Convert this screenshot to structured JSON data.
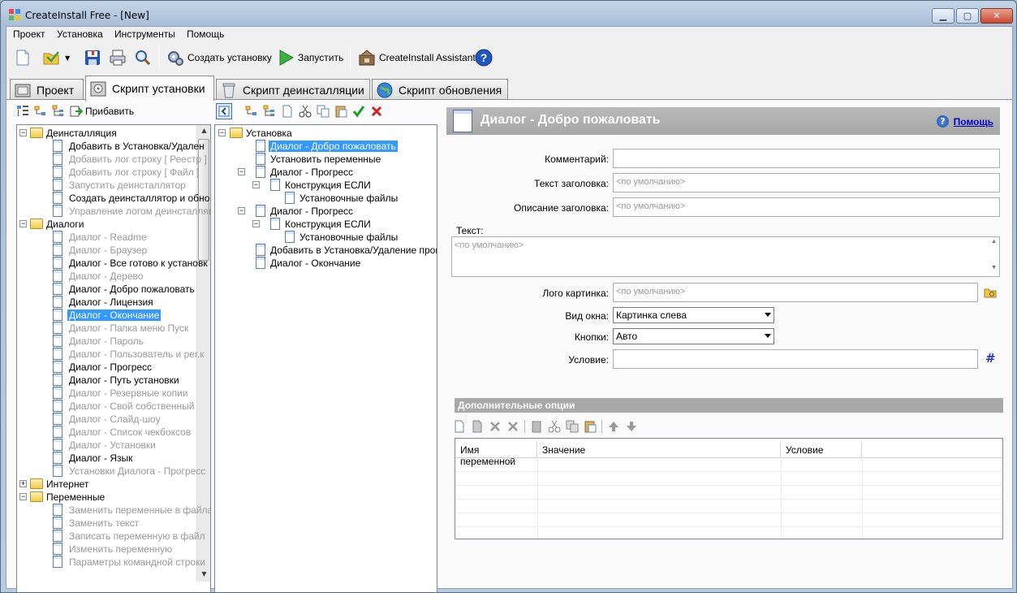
{
  "window": {
    "title": "CreateInstall Free - [New]",
    "min": "▁",
    "max": "▢",
    "close": "✕"
  },
  "menu": [
    "Проект",
    "Установка",
    "Инструменты",
    "Помощь"
  ],
  "toolbar": {
    "create_install": "Создать установку",
    "run": "Запустить",
    "assistant": "CreateInstall Assistant"
  },
  "tabs": [
    "Проект",
    "Скрипт установки",
    "Скрипт деинсталляции",
    "Скрипт обновления"
  ],
  "left_toolbar": {
    "add": "Прибавить"
  },
  "left_tree": [
    {
      "label": "Деинсталляция",
      "type": "folder",
      "state": "expanded"
    },
    {
      "label": "Добавить в Установка/Удален",
      "type": "doc"
    },
    {
      "label": "Добавить лог строку [ Реестр ]",
      "type": "doc",
      "disabled": true
    },
    {
      "label": "Добавить лог строку [ Файл ]",
      "type": "doc",
      "disabled": true
    },
    {
      "label": "Запустить деинсталлятор",
      "type": "doc",
      "disabled": true
    },
    {
      "label": "Создать деинсталлятор и обнов",
      "type": "doc"
    },
    {
      "label": "Управление логом деинсталляц",
      "type": "doc",
      "disabled": true
    },
    {
      "label": "Диалоги",
      "type": "folder",
      "state": "expanded"
    },
    {
      "label": "Диалог - Readme",
      "type": "doc",
      "disabled": true
    },
    {
      "label": "Диалог - Браузер",
      "type": "doc",
      "disabled": true
    },
    {
      "label": "Диалог - Все готово к установк",
      "type": "doc"
    },
    {
      "label": "Диалог - Дерево",
      "type": "doc",
      "disabled": true
    },
    {
      "label": "Диалог - Добро пожаловать",
      "type": "doc"
    },
    {
      "label": "Диалог - Лицензия",
      "type": "doc"
    },
    {
      "label": "Диалог - Окончание",
      "type": "doc",
      "selected": true
    },
    {
      "label": "Диалог - Папка меню Пуск",
      "type": "doc",
      "disabled": true
    },
    {
      "label": "Диалог - Пароль",
      "type": "doc",
      "disabled": true
    },
    {
      "label": "Диалог - Пользователь и рег.к",
      "type": "doc",
      "disabled": true
    },
    {
      "label": "Диалог - Прогресс",
      "type": "doc"
    },
    {
      "label": "Диалог - Путь установки",
      "type": "doc"
    },
    {
      "label": "Диалог - Резервные копии",
      "type": "doc",
      "disabled": true
    },
    {
      "label": "Диалог - Свой собственный",
      "type": "doc",
      "disabled": true
    },
    {
      "label": "Диалог - Слайд-шоу",
      "type": "doc",
      "disabled": true
    },
    {
      "label": "Диалог - Список чекбоксов",
      "type": "doc",
      "disabled": true
    },
    {
      "label": "Диалог - Установки",
      "type": "doc",
      "disabled": true
    },
    {
      "label": "Диалог - Язык",
      "type": "doc"
    },
    {
      "label": "Установки Диалога - Прогресс",
      "type": "doc",
      "disabled": true
    },
    {
      "label": "Интернет",
      "type": "folder",
      "state": "collapsed"
    },
    {
      "label": "Переменные",
      "type": "folder",
      "state": "expanded"
    },
    {
      "label": "Заменить переменные в файла",
      "type": "doc",
      "disabled": true
    },
    {
      "label": "Заменить текст",
      "type": "doc",
      "disabled": true
    },
    {
      "label": "Записать переменную в файл",
      "type": "doc",
      "disabled": true
    },
    {
      "label": "Изменить переменную",
      "type": "doc",
      "disabled": true
    },
    {
      "label": "Параметры командной строки",
      "type": "doc",
      "disabled": true
    }
  ],
  "script_tree": [
    {
      "label": "Установка",
      "level": 0,
      "type": "folder"
    },
    {
      "label": "Диалог - Добро пожаловать",
      "level": 1,
      "type": "doc",
      "selected": true
    },
    {
      "label": "Установить переменные",
      "level": 1,
      "type": "doc"
    },
    {
      "label": "Диалог - Прогресс",
      "level": 1,
      "type": "doc",
      "exp": true
    },
    {
      "label": "Конструкция ЕСЛИ",
      "level": 2,
      "type": "doc",
      "exp": true
    },
    {
      "label": "Установочные файлы",
      "level": 3,
      "type": "doc"
    },
    {
      "label": "Диалог - Прогресс",
      "level": 1,
      "type": "doc",
      "exp": true
    },
    {
      "label": "Конструкция ЕСЛИ",
      "level": 2,
      "type": "doc",
      "exp": true
    },
    {
      "label": "Установочные файлы",
      "level": 3,
      "type": "doc"
    },
    {
      "label": "Добавить в Установка/Удаление програ",
      "level": 1,
      "type": "doc"
    },
    {
      "label": "Диалог - Окончание",
      "level": 1,
      "type": "doc"
    }
  ],
  "detail": {
    "title": "Диалог - Добро пожаловать",
    "help": "Помощь",
    "comment_label": "Комментарий:",
    "comment_value": "",
    "header_text_label": "Текст заголовка:",
    "header_text_placeholder": "<по умолчанию>",
    "header_desc_label": "Описание заголовка:",
    "header_desc_placeholder": "<по умолчанию>",
    "text_label": "Текст:",
    "text_placeholder": "<по умолчанию>",
    "logo_label": "Лого картинка:",
    "logo_placeholder": "<по умолчанию>",
    "window_type_label": "Вид окна:",
    "window_type_value": "Картинка слева",
    "buttons_label": "Кнопки:",
    "buttons_value": "Авто",
    "condition_label": "Условие:",
    "condition_value": "",
    "condition_icon": "#",
    "extra_options": "Дополнительные опции",
    "grid_headers": [
      "Имя переменной",
      "Значение",
      "Условие"
    ]
  }
}
